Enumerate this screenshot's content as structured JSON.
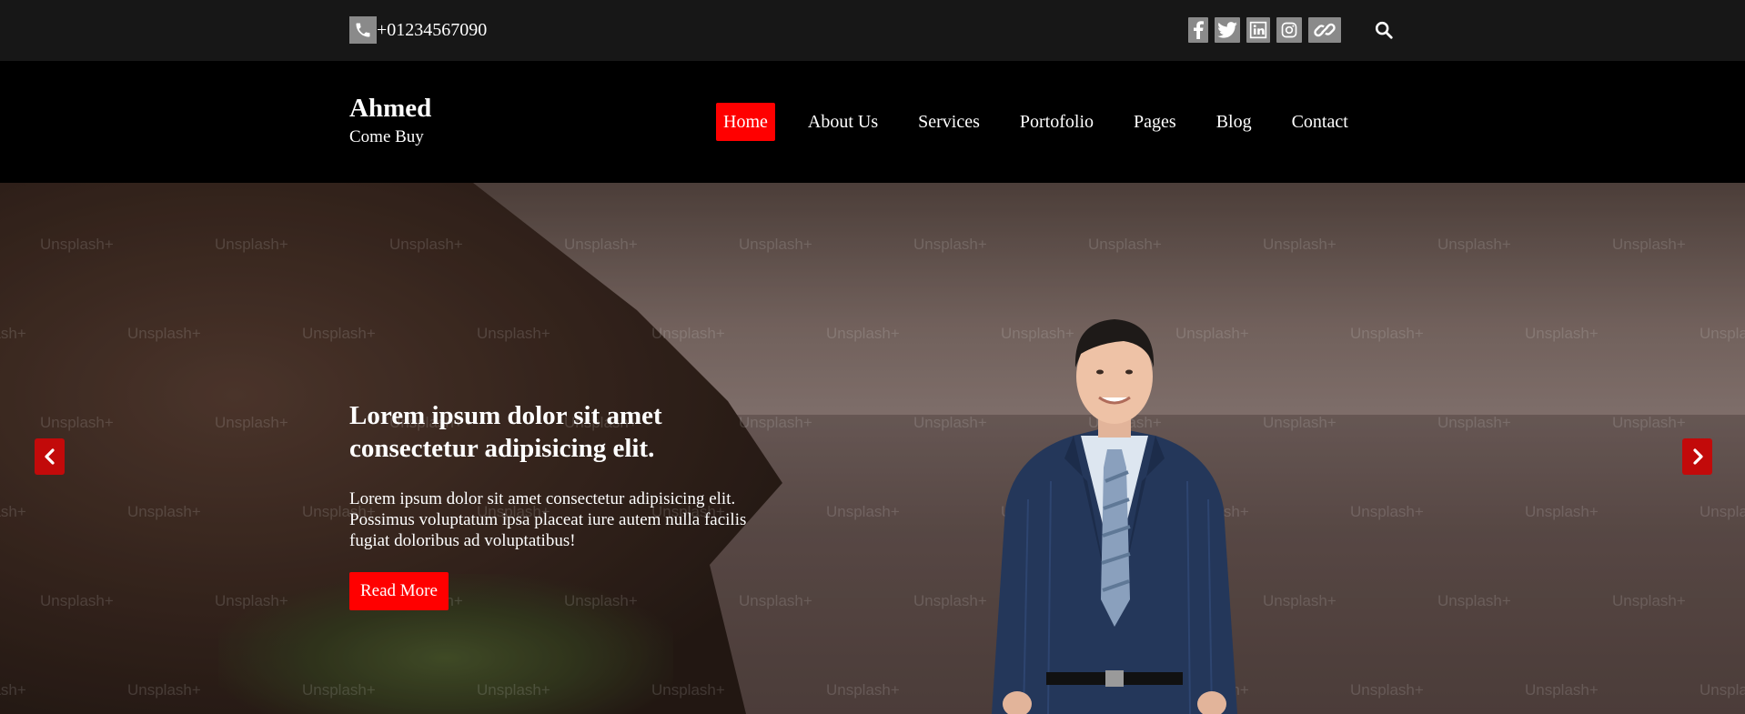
{
  "topbar": {
    "phone": "+01234567090",
    "phone_icon": "phone-icon",
    "socials": [
      "facebook-icon",
      "twitter-icon",
      "linkedin-icon",
      "instagram-icon",
      "link-icon"
    ],
    "search_icon": "search-icon"
  },
  "brand": {
    "name": "Ahmed",
    "tagline": "Come Buy"
  },
  "nav": {
    "items": [
      {
        "label": "Home",
        "active": true
      },
      {
        "label": "About Us",
        "active": false
      },
      {
        "label": "Services",
        "active": false
      },
      {
        "label": "Portofolio",
        "active": false
      },
      {
        "label": "Pages",
        "active": false
      },
      {
        "label": "Blog",
        "active": false
      },
      {
        "label": "Contact",
        "active": false
      }
    ]
  },
  "hero": {
    "title": "Lorem ipsum dolor sit amet consectetur adipisicing elit.",
    "text": "Lorem ipsum dolor sit amet consectetur adipisicing elit. Possimus voluptatum ipsa placeat iure autem nulla facilis fugiat doloribus ad voluptatibus!",
    "button": "Read More",
    "watermark": "Unsplash+",
    "prev_icon": "chevron-left-icon",
    "next_icon": "chevron-right-icon"
  },
  "colors": {
    "accent": "#ff0000",
    "arrow": "#c20a0a",
    "topbar_bg": "#171717",
    "header_bg": "#000000",
    "icon_bg": "#8a8a8a"
  }
}
